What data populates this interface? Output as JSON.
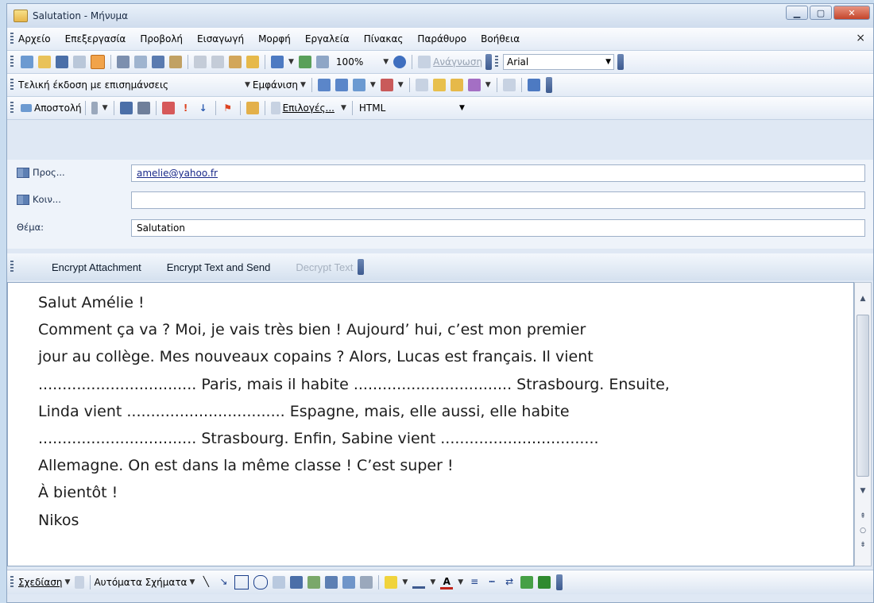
{
  "window": {
    "title": "Salutation - Μήνυμα",
    "controls": [
      "minimize",
      "maximize",
      "close"
    ]
  },
  "menu": {
    "items": [
      "Αρχείο",
      "Επεξεργασία",
      "Προβολή",
      "Εισαγωγή",
      "Μορφή",
      "Εργαλεία",
      "Πίνακας",
      "Παράθυρο",
      "Βοήθεια"
    ],
    "close": "×"
  },
  "standard_toolbar": {
    "zoom": "100%",
    "read_button": "Ανάγνωση",
    "font": "Arial"
  },
  "review_toolbar": {
    "mode": "Τελική έκδοση με επισημάνσεις",
    "show_button": "Εμφάνιση"
  },
  "mail_toolbar": {
    "send_button": "Αποστολή",
    "options_button": "Επιλογές...",
    "format": "HTML"
  },
  "address": {
    "to_label": "Προς...",
    "to_value": "amelie@yahoo.fr",
    "cc_label": "Κοιν...",
    "cc_value": "",
    "subject_label": "Θέμα:",
    "subject_value": "Salutation"
  },
  "encrypt_toolbar": {
    "encrypt_attachment": "Encrypt Attachment",
    "encrypt_text_send": "Encrypt Text and Send",
    "decrypt_text": "Decrypt Text"
  },
  "message_body": [
    "Salut Amélie !",
    "Comment ça va ? Moi, je vais très bien ! Aujourd’ hui, c’est mon premier",
    "jour au collège. Mes nouveaux copains ? Alors, Lucas est français. Il vient",
    "................................. Paris, mais il habite ................................. Strasbourg. Ensuite,",
    "Linda vient ................................. Espagne, mais, elle aussi, elle habite",
    "................................. Strasbourg. Enfin, Sabine vient .................................",
    "Allemagne. On est dans la même classe ! C’est super !",
    "À bientôt !",
    "Nikos"
  ],
  "drawing_toolbar": {
    "draw_menu": "Σχεδίαση",
    "autoshapes_menu": "Αυτόματα Σχήματα"
  },
  "colors": {
    "toolbar_bg": "#e3ebf6",
    "title_bg": "#cfdced",
    "close_btn": "#c4452b",
    "accent": "#3d5a8f"
  }
}
